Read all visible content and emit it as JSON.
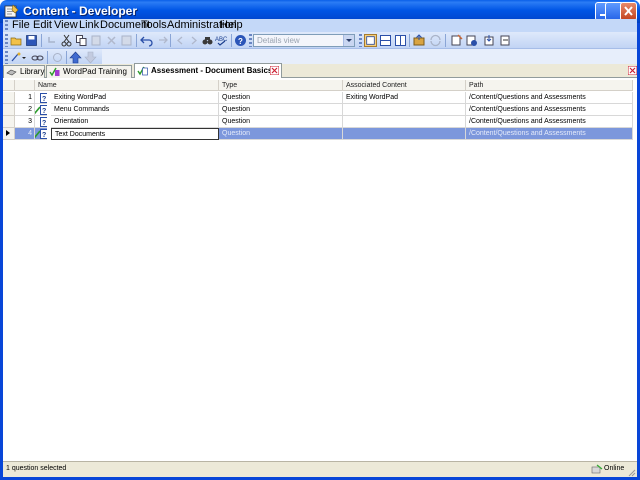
{
  "window": {
    "title": "Content - Developer",
    "accent": "#0055e5"
  },
  "menu": [
    {
      "label": "File",
      "icon": "",
      "underline": "F"
    },
    {
      "label": "Edit",
      "underline": "E"
    },
    {
      "label": "View",
      "underline": "V"
    },
    {
      "label": "Link",
      "underline": "L"
    },
    {
      "label": "Document",
      "underline": "D"
    },
    {
      "label": "Tools",
      "underline": "T"
    },
    {
      "label": "Administration",
      "underline": "A"
    },
    {
      "label": "Help",
      "underline": "H"
    }
  ],
  "toolbar": {
    "view_select": "Details view"
  },
  "tabs": [
    {
      "label": "Library",
      "icon": "library-icon",
      "active": false
    },
    {
      "label": "WordPad Training",
      "icon": "module-icon",
      "active": false
    },
    {
      "label": "Assessment - Document Basics",
      "icon": "assessment-icon",
      "active": true
    }
  ],
  "grid": {
    "columns": [
      "Name",
      "Type",
      "Associated Content",
      "Path"
    ],
    "rows": [
      {
        "num": "1",
        "checked": false,
        "name": "Exiting WordPad",
        "type": "Question",
        "content": "Exiting WordPad",
        "path": "/Content/Questions and Assessments",
        "selected": false
      },
      {
        "num": "2",
        "checked": true,
        "name": "Menu Commands",
        "type": "Question",
        "content": "",
        "path": "/Content/Questions and Assessments",
        "selected": false
      },
      {
        "num": "3",
        "checked": false,
        "name": "Orientation",
        "type": "Question",
        "content": "",
        "path": "/Content/Questions and Assessments",
        "selected": false
      },
      {
        "num": "4",
        "checked": true,
        "name": "Text Documents",
        "type": "Question",
        "content": "",
        "path": "/Content/Questions and Assessments",
        "selected": true
      }
    ]
  },
  "status": {
    "text": "1 question selected",
    "connection": "Online"
  }
}
